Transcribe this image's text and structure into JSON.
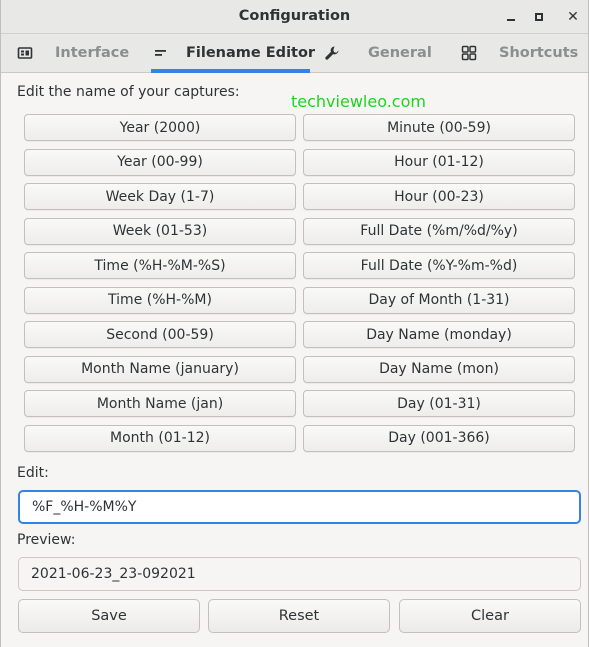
{
  "window": {
    "title": "Configuration",
    "controls": {
      "minimize": "minimize",
      "maximize": "maximize",
      "close": "✕"
    }
  },
  "tabs": [
    {
      "label": "Interface",
      "icon": "interface-icon",
      "active": false
    },
    {
      "label": "Filename Editor",
      "icon": "text-lines-icon",
      "active": true
    },
    {
      "label": "General",
      "icon": "wrench-icon",
      "active": false
    },
    {
      "label": "Shortcuts",
      "icon": "grid-icon",
      "active": false
    }
  ],
  "editor": {
    "heading": "Edit the name of your captures:",
    "watermark": "techviewleo.com",
    "buttons_left": [
      "Year (2000)",
      "Year (00-99)",
      "Week Day (1-7)",
      "Week (01-53)",
      "Time (%H-%M-%S)",
      "Time (%H-%M)",
      "Second (00-59)",
      "Month Name (january)",
      "Month Name (jan)",
      "Month (01-12)"
    ],
    "buttons_right": [
      "Minute (00-59)",
      "Hour (01-12)",
      "Hour (00-23)",
      "Full Date (%m/%d/%y)",
      "Full Date (%Y-%m-%d)",
      "Day of Month (1-31)",
      "Day Name (monday)",
      "Day Name (mon)",
      "Day (01-31)",
      "Day (001-366)"
    ],
    "edit_label": "Edit:",
    "edit_value": "%F_%H-%M%Y",
    "preview_label": "Preview:",
    "preview_value": "2021-06-23_23-092021",
    "actions": {
      "save": "Save",
      "reset": "Reset",
      "clear": "Clear"
    }
  },
  "colors": {
    "accent": "#3584e4",
    "watermark": "#1fd31f"
  }
}
